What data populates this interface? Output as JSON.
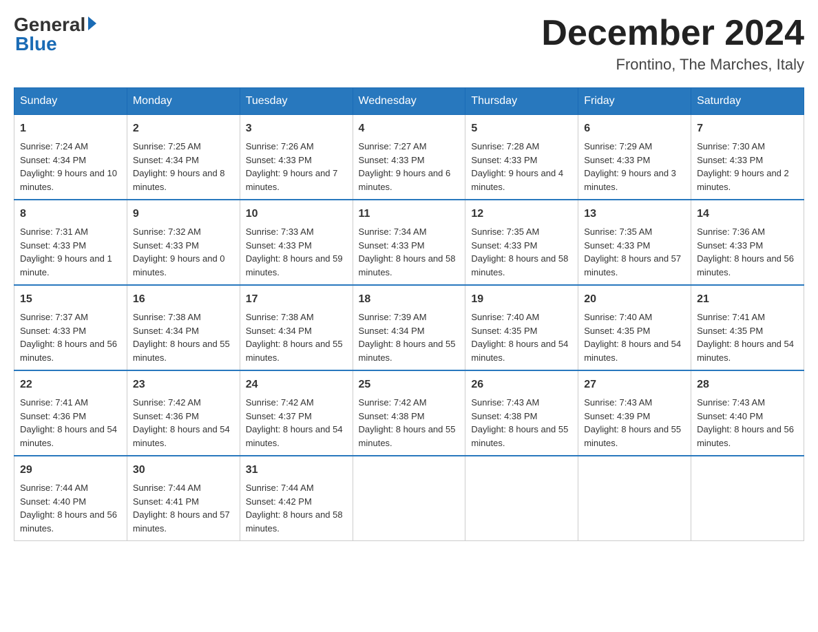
{
  "logo": {
    "general": "General",
    "blue": "Blue"
  },
  "title": "December 2024",
  "location": "Frontino, The Marches, Italy",
  "days_of_week": [
    "Sunday",
    "Monday",
    "Tuesday",
    "Wednesday",
    "Thursday",
    "Friday",
    "Saturday"
  ],
  "weeks": [
    [
      {
        "day": "1",
        "sunrise": "7:24 AM",
        "sunset": "4:34 PM",
        "daylight": "9 hours and 10 minutes."
      },
      {
        "day": "2",
        "sunrise": "7:25 AM",
        "sunset": "4:34 PM",
        "daylight": "9 hours and 8 minutes."
      },
      {
        "day": "3",
        "sunrise": "7:26 AM",
        "sunset": "4:33 PM",
        "daylight": "9 hours and 7 minutes."
      },
      {
        "day": "4",
        "sunrise": "7:27 AM",
        "sunset": "4:33 PM",
        "daylight": "9 hours and 6 minutes."
      },
      {
        "day": "5",
        "sunrise": "7:28 AM",
        "sunset": "4:33 PM",
        "daylight": "9 hours and 4 minutes."
      },
      {
        "day": "6",
        "sunrise": "7:29 AM",
        "sunset": "4:33 PM",
        "daylight": "9 hours and 3 minutes."
      },
      {
        "day": "7",
        "sunrise": "7:30 AM",
        "sunset": "4:33 PM",
        "daylight": "9 hours and 2 minutes."
      }
    ],
    [
      {
        "day": "8",
        "sunrise": "7:31 AM",
        "sunset": "4:33 PM",
        "daylight": "9 hours and 1 minute."
      },
      {
        "day": "9",
        "sunrise": "7:32 AM",
        "sunset": "4:33 PM",
        "daylight": "9 hours and 0 minutes."
      },
      {
        "day": "10",
        "sunrise": "7:33 AM",
        "sunset": "4:33 PM",
        "daylight": "8 hours and 59 minutes."
      },
      {
        "day": "11",
        "sunrise": "7:34 AM",
        "sunset": "4:33 PM",
        "daylight": "8 hours and 58 minutes."
      },
      {
        "day": "12",
        "sunrise": "7:35 AM",
        "sunset": "4:33 PM",
        "daylight": "8 hours and 58 minutes."
      },
      {
        "day": "13",
        "sunrise": "7:35 AM",
        "sunset": "4:33 PM",
        "daylight": "8 hours and 57 minutes."
      },
      {
        "day": "14",
        "sunrise": "7:36 AM",
        "sunset": "4:33 PM",
        "daylight": "8 hours and 56 minutes."
      }
    ],
    [
      {
        "day": "15",
        "sunrise": "7:37 AM",
        "sunset": "4:33 PM",
        "daylight": "8 hours and 56 minutes."
      },
      {
        "day": "16",
        "sunrise": "7:38 AM",
        "sunset": "4:34 PM",
        "daylight": "8 hours and 55 minutes."
      },
      {
        "day": "17",
        "sunrise": "7:38 AM",
        "sunset": "4:34 PM",
        "daylight": "8 hours and 55 minutes."
      },
      {
        "day": "18",
        "sunrise": "7:39 AM",
        "sunset": "4:34 PM",
        "daylight": "8 hours and 55 minutes."
      },
      {
        "day": "19",
        "sunrise": "7:40 AM",
        "sunset": "4:35 PM",
        "daylight": "8 hours and 54 minutes."
      },
      {
        "day": "20",
        "sunrise": "7:40 AM",
        "sunset": "4:35 PM",
        "daylight": "8 hours and 54 minutes."
      },
      {
        "day": "21",
        "sunrise": "7:41 AM",
        "sunset": "4:35 PM",
        "daylight": "8 hours and 54 minutes."
      }
    ],
    [
      {
        "day": "22",
        "sunrise": "7:41 AM",
        "sunset": "4:36 PM",
        "daylight": "8 hours and 54 minutes."
      },
      {
        "day": "23",
        "sunrise": "7:42 AM",
        "sunset": "4:36 PM",
        "daylight": "8 hours and 54 minutes."
      },
      {
        "day": "24",
        "sunrise": "7:42 AM",
        "sunset": "4:37 PM",
        "daylight": "8 hours and 54 minutes."
      },
      {
        "day": "25",
        "sunrise": "7:42 AM",
        "sunset": "4:38 PM",
        "daylight": "8 hours and 55 minutes."
      },
      {
        "day": "26",
        "sunrise": "7:43 AM",
        "sunset": "4:38 PM",
        "daylight": "8 hours and 55 minutes."
      },
      {
        "day": "27",
        "sunrise": "7:43 AM",
        "sunset": "4:39 PM",
        "daylight": "8 hours and 55 minutes."
      },
      {
        "day": "28",
        "sunrise": "7:43 AM",
        "sunset": "4:40 PM",
        "daylight": "8 hours and 56 minutes."
      }
    ],
    [
      {
        "day": "29",
        "sunrise": "7:44 AM",
        "sunset": "4:40 PM",
        "daylight": "8 hours and 56 minutes."
      },
      {
        "day": "30",
        "sunrise": "7:44 AM",
        "sunset": "4:41 PM",
        "daylight": "8 hours and 57 minutes."
      },
      {
        "day": "31",
        "sunrise": "7:44 AM",
        "sunset": "4:42 PM",
        "daylight": "8 hours and 58 minutes."
      },
      null,
      null,
      null,
      null
    ]
  ],
  "labels": {
    "sunrise": "Sunrise:",
    "sunset": "Sunset:",
    "daylight": "Daylight:"
  }
}
